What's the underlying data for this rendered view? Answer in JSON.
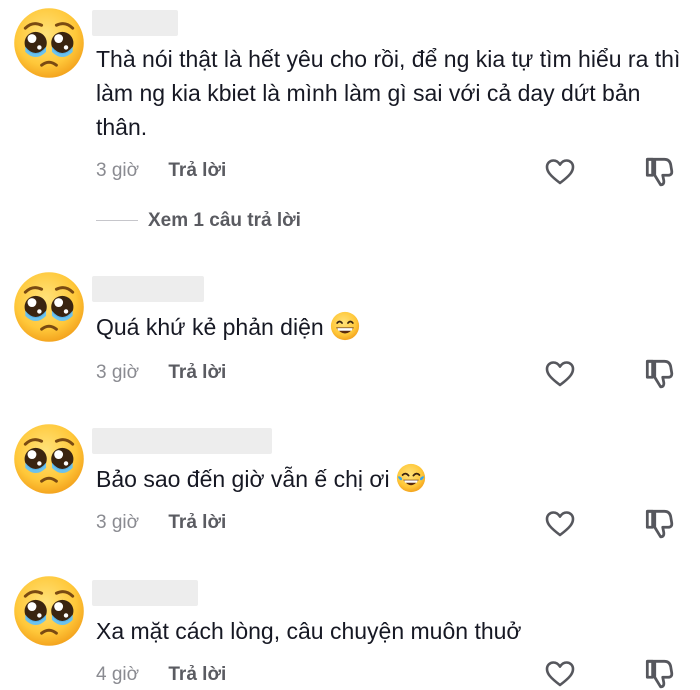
{
  "comments": [
    {
      "text": "Thà nói thật là hết yêu cho rồi, để ng kia tự tìm hiểu ra thì làm ng kia kbiet là mình làm gì sai với cả day dứt bản thân.",
      "time": "3 giờ",
      "reply_label": "Trả lời",
      "avatar_icon": "pleading-face-emoji",
      "view_replies": "Xem 1 câu trả lời"
    },
    {
      "text": "Quá khứ kẻ phản diện",
      "trailing_emoji": "grinning-face-emoji",
      "time": "3 giờ",
      "reply_label": "Trả lời",
      "avatar_icon": "pleading-face-emoji"
    },
    {
      "text": "Bảo sao đến giờ vẫn ế chị ơi",
      "trailing_emoji": "tears-of-joy-emoji",
      "time": "3 giờ",
      "reply_label": "Trả lời",
      "avatar_icon": "pleading-face-emoji"
    },
    {
      "text": "Xa mặt cách lòng, câu chuyện muôn thuở",
      "time": "4 giờ",
      "reply_label": "Trả lời",
      "avatar_icon": "pleading-face-emoji"
    }
  ],
  "icons": {
    "like": "heart-outline-icon",
    "dislike": "thumbs-down-icon"
  },
  "colors": {
    "text": "#161823",
    "meta": "#8a8b91",
    "reply": "#5a5b61",
    "emoji_face": "#ffcb3d",
    "tear": "#3ba6e8"
  }
}
